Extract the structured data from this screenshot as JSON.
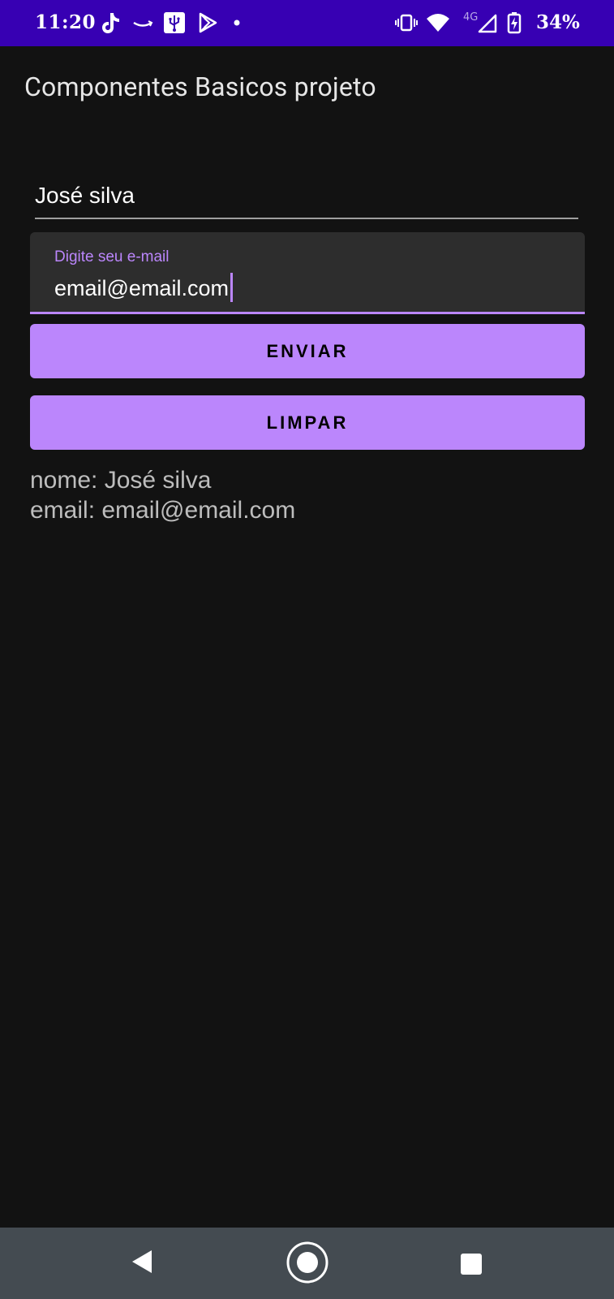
{
  "status_bar": {
    "time": "11:20",
    "network": "4G",
    "battery": "34%",
    "icons": [
      "tiktok-icon",
      "amazon-icon",
      "usb-icon",
      "play-store-icon",
      "notification-dot-icon",
      "vibrate-icon",
      "wifi-icon",
      "signal-icon",
      "battery-icon"
    ]
  },
  "app_bar": {
    "title": "Componentes Basicos projeto"
  },
  "form": {
    "name_value": "José silva",
    "email_label": "Digite seu e-mail",
    "email_value": "email@email.com"
  },
  "buttons": {
    "send_label": "ENVIAR",
    "clear_label": "LIMPAR"
  },
  "output": {
    "name_line": "nome: José silva",
    "email_line": "email: email@email.com"
  },
  "nav_bar": {
    "icons": [
      "back-icon",
      "home-icon",
      "recents-icon"
    ]
  },
  "colors": {
    "status_bar": "#3700b3",
    "background": "#121212",
    "accent": "#bb86fc",
    "nav_bar": "#444b51"
  }
}
